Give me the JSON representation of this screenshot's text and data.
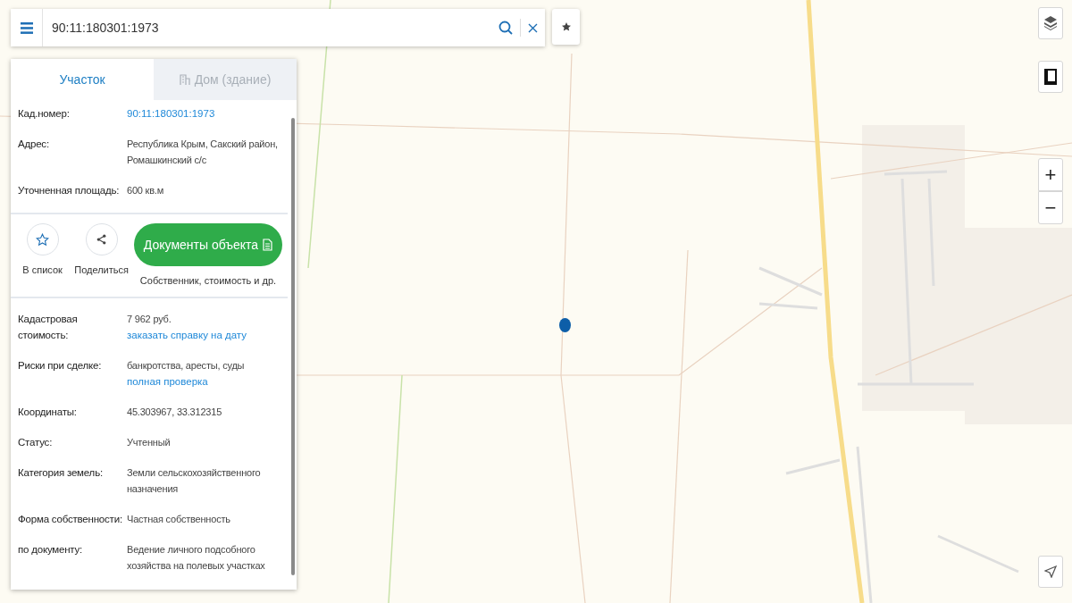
{
  "search": {
    "value": "90:11:180301:1973"
  },
  "tabs": [
    {
      "label": "Участок",
      "selected": true
    },
    {
      "label": "Дом (здание)",
      "selected": false
    }
  ],
  "summary": [
    {
      "label": "Кад.номер:",
      "lines": [
        {
          "text": "90:11:180301:1973",
          "kind": "link"
        }
      ]
    },
    {
      "label": "Адрес:",
      "lines": [
        {
          "text": "Республика Крым, Сакский район, Ромашкинский с/с",
          "kind": "text"
        }
      ]
    },
    {
      "label": "Уточненная площадь:",
      "lines": [
        {
          "text": "600 кв.м",
          "kind": "text"
        }
      ]
    }
  ],
  "actions": [
    {
      "label": "В список",
      "kind": "star"
    },
    {
      "label": "Поделиться",
      "kind": "share"
    }
  ],
  "documents": {
    "label": "Документы объекта",
    "caption": "Собственник, стоимость и др."
  },
  "details": [
    {
      "label": "Кадастровая стоимость:",
      "lines": [
        {
          "text": "7 962 руб.",
          "kind": "text"
        },
        {
          "text": "заказать справку на дату",
          "kind": "link"
        }
      ]
    },
    {
      "label": "Риски при сделке:",
      "lines": [
        {
          "text": "банкротства, аресты, суды",
          "kind": "text"
        },
        {
          "text": "полная проверка",
          "kind": "link"
        }
      ]
    },
    {
      "label": "Координаты:",
      "lines": [
        {
          "text": "45.303967, 33.312315",
          "kind": "text"
        }
      ]
    },
    {
      "label": "Статус:",
      "lines": [
        {
          "text": "Учтенный",
          "kind": "text"
        }
      ]
    },
    {
      "label": "Категория земель:",
      "lines": [
        {
          "text": "Земли сельскохозяйственного назначения",
          "kind": "text"
        }
      ]
    },
    {
      "label": "Форма собственности:",
      "lines": [
        {
          "text": "Частная собственность",
          "kind": "text"
        }
      ]
    },
    {
      "label": "по документу:",
      "lines": [
        {
          "text": "Ведение личного подсобного хозяйства на полевых участках",
          "kind": "text"
        }
      ]
    }
  ],
  "map_controls": {
    "zoom_in": "+",
    "zoom_out": "−"
  }
}
